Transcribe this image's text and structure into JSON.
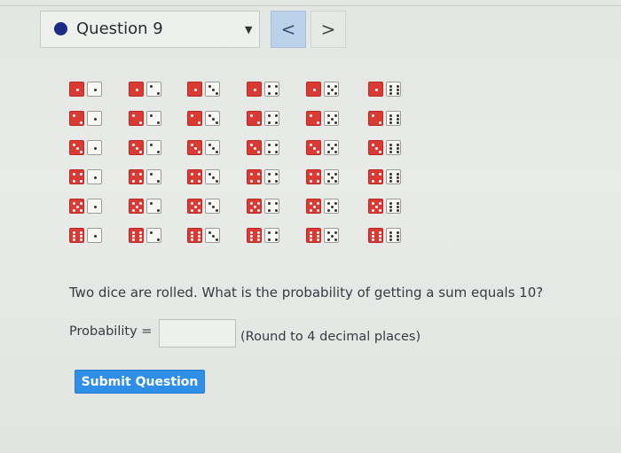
{
  "header": {
    "question_title": "Question 9",
    "prev_label": "<",
    "next_label": ">",
    "dropdown_caret": "▼"
  },
  "dice_grid": {
    "rows": 6,
    "cols": 6,
    "red_die_color": "#d93a33",
    "white_die_color": "#f7f7f5",
    "description_rows_first_die": [
      1,
      2,
      3,
      4,
      5,
      6
    ],
    "description_cols_second_die": [
      1,
      2,
      3,
      4,
      5,
      6
    ]
  },
  "question": {
    "text": "Two dice are rolled. What is the probability of getting a sum equals 10?",
    "probability_label": "Probability =",
    "answer_value": "",
    "round_hint": "(Round to 4 decimal places)"
  },
  "submit": {
    "label": "Submit Question",
    "color": "#2f8ee5"
  }
}
